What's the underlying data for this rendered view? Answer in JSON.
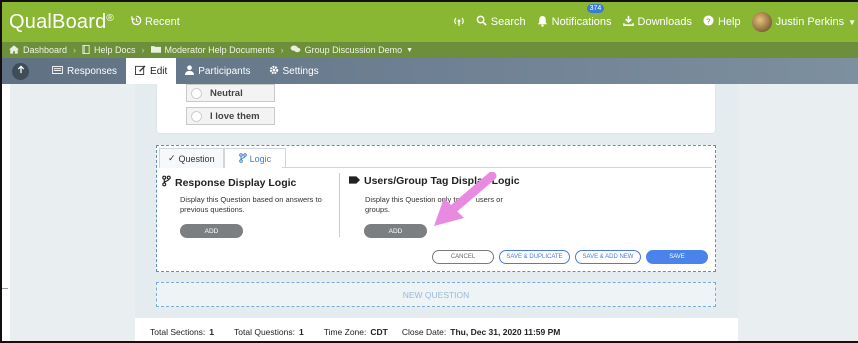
{
  "app": {
    "logo": "QualBoard",
    "logo_mark": "®",
    "recent_label": "Recent"
  },
  "topnav": {
    "search_label": "Search",
    "notifications_label": "Notifications",
    "notifications_count": "374",
    "downloads_label": "Downloads",
    "help_label": "Help",
    "user_name": "Justin Perkins"
  },
  "breadcrumb": {
    "items": [
      "Dashboard",
      "Help Docs",
      "Moderator Help Documents",
      "Group Discussion Demo"
    ]
  },
  "tabs": {
    "responses": "Responses",
    "edit": "Edit",
    "participants": "Participants",
    "settings": "Settings"
  },
  "question_options": [
    "Neutral",
    "I love them"
  ],
  "logic_tabs": {
    "question": "Question",
    "logic": "Logic"
  },
  "response_logic": {
    "title": "Response Display Logic",
    "desc": "Display this Question based on answers to previous questions.",
    "add_label": "ADD"
  },
  "tag_logic": {
    "title": "Users/Group Tag Display Logic",
    "desc_line1": "Display this Question only to",
    "desc_line1b": "users or",
    "desc_line2": "groups.",
    "add_label": "ADD"
  },
  "actions": {
    "cancel": "CANCEL",
    "save_duplicate": "SAVE & DUPLICATE",
    "save_add_new": "SAVE & ADD NEW",
    "save": "SAVE"
  },
  "new_question_label": "NEW QUESTION",
  "footer": {
    "sections_label": "Total Sections:",
    "sections_value": "1",
    "questions_label": "Total Questions:",
    "questions_value": "1",
    "timezone_label": "Time Zone:",
    "timezone_value": "CDT",
    "close_label": "Close Date:",
    "close_value": "Thu, Dec 31, 2020 11:59 PM"
  },
  "colors": {
    "topbar": "#8ab733",
    "breadcrumb_bar": "#6d8f3c",
    "accent_blue": "#4a84ea",
    "arrow": "#e88be0"
  },
  "icons": [
    "history-icon",
    "antenna-icon",
    "search-icon",
    "bell-icon",
    "download-icon",
    "help-icon",
    "home-icon",
    "book-icon",
    "folder-icon",
    "chat-icon",
    "back-icon",
    "responses-icon",
    "edit-icon",
    "user-icon",
    "gear-icon",
    "check-icon",
    "branch-icon",
    "tag-icon"
  ]
}
